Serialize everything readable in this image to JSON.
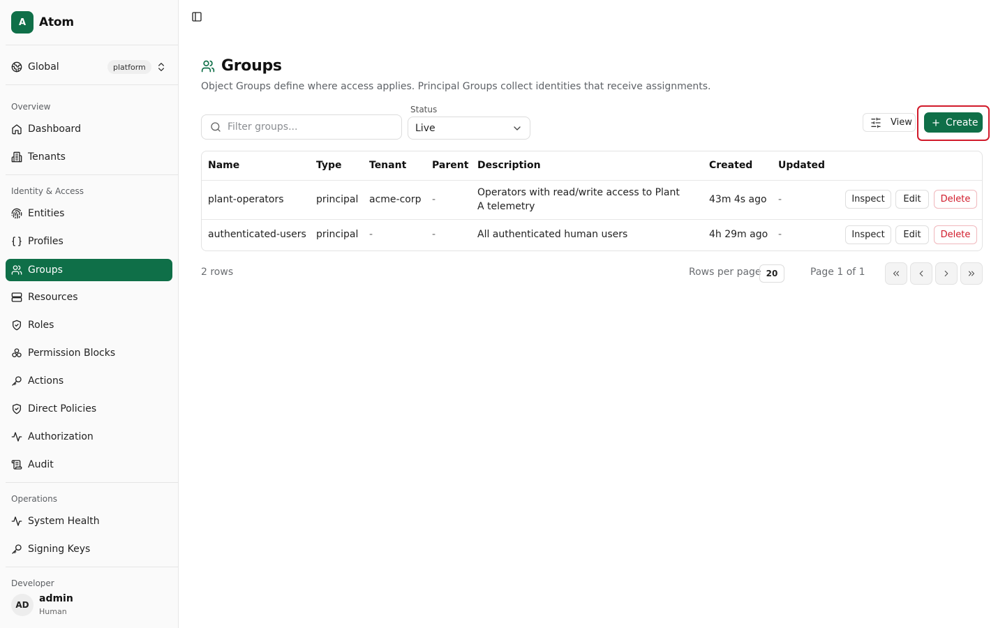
{
  "app": {
    "initial": "A",
    "name": "Atom"
  },
  "scope": {
    "label": "Global",
    "badge": "platform"
  },
  "sidebar": {
    "sections": [
      {
        "label": "Overview",
        "items": [
          {
            "label": "Dashboard",
            "icon": "home-icon"
          },
          {
            "label": "Tenants",
            "icon": "building-icon"
          }
        ]
      },
      {
        "label": "Identity & Access",
        "items": [
          {
            "label": "Entities",
            "icon": "fingerprint-icon"
          },
          {
            "label": "Profiles",
            "icon": "braces-icon"
          },
          {
            "label": "Groups",
            "icon": "users-icon",
            "active": true
          },
          {
            "label": "Resources",
            "icon": "server-icon"
          },
          {
            "label": "Roles",
            "icon": "shield-check-icon"
          },
          {
            "label": "Permission Blocks",
            "icon": "blocks-icon"
          },
          {
            "label": "Actions",
            "icon": "key-icon"
          },
          {
            "label": "Direct Policies",
            "icon": "shield-check-icon"
          },
          {
            "label": "Authorization",
            "icon": "activity-icon"
          },
          {
            "label": "Audit",
            "icon": "scroll-icon"
          }
        ]
      },
      {
        "label": "Operations",
        "items": [
          {
            "label": "System Health",
            "icon": "activity-icon"
          },
          {
            "label": "Signing Keys",
            "icon": "key-icon"
          }
        ]
      },
      {
        "label": "Developer",
        "items": []
      }
    ]
  },
  "user": {
    "initials": "AD",
    "name": "admin",
    "kind": "Human"
  },
  "page": {
    "title": "Groups",
    "description": "Object Groups define where access applies. Principal Groups collect identities that receive assignments."
  },
  "toolbar": {
    "filter_placeholder": "Filter groups...",
    "status_label": "Status",
    "status_value": "Live",
    "view_label": "View",
    "create_label": "Create"
  },
  "table": {
    "columns": [
      "Name",
      "Type",
      "Tenant",
      "Parent",
      "Description",
      "Created",
      "Updated"
    ],
    "rows": [
      {
        "name": "plant-operators",
        "type": "principal",
        "tenant": "acme-corp",
        "parent": "-",
        "description": "Operators with read/write access to Plant A telemetry",
        "created": "43m 4s ago",
        "updated": "-"
      },
      {
        "name": "authenticated-users",
        "type": "principal",
        "tenant": "-",
        "parent": "-",
        "description": "All authenticated human users",
        "created": "4h 29m ago",
        "updated": "-"
      }
    ],
    "actions": {
      "inspect": "Inspect",
      "edit": "Edit",
      "delete": "Delete"
    }
  },
  "pagination": {
    "rows_count": "2 rows",
    "rows_per_page_label": "Rows per page",
    "rows_per_page_value": "20",
    "page_info": "Page 1 of 1"
  },
  "colors": {
    "brand": "#0f6f48",
    "danger": "#d11a2a"
  }
}
